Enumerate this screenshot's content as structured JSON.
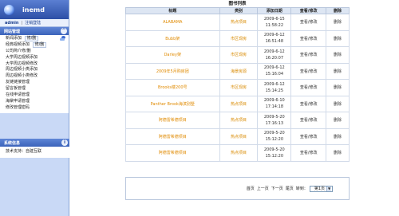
{
  "app": {
    "logo_text": "inemd"
  },
  "userbar": {
    "user": "admin",
    "sep": "|",
    "logout": "注销登陆"
  },
  "sidebar": {
    "section_title": "网站管理",
    "items": [
      {
        "label": "新闻添加",
        "sub": "修/删"
      },
      {
        "label": "经典视频添加",
        "sub": "修/删"
      },
      {
        "label": "公司简介修/删"
      },
      {
        "label": "大学周边视频添加"
      },
      {
        "label": "大学周边视频修改"
      },
      {
        "label": "周边视频小类添加"
      },
      {
        "label": "周边视频小类修改"
      },
      {
        "label": "友链链接管理"
      },
      {
        "label": "留言板管理"
      },
      {
        "label": "在线申请管理"
      },
      {
        "label": "海棠申请管理"
      },
      {
        "label": "修改管理密码"
      }
    ],
    "system_title": "系统信息",
    "system_text": "技术支持：自建互联"
  },
  "main": {
    "title": "图书列表",
    "columns": [
      "标题",
      "类别",
      "添加日期",
      "查看/修改",
      "删除"
    ],
    "rows": [
      {
        "title": "ALABAMA",
        "category": "热点项目",
        "date": "2009-6-15",
        "time": "11:58:22",
        "edit": "查看/修改",
        "del": "删除"
      },
      {
        "title": "Bubb架",
        "category": "市区现房",
        "date": "2009-6-12",
        "time": "16:51:48",
        "edit": "查看/修改",
        "del": "删除"
      },
      {
        "title": "Darley架",
        "category": "市区现房",
        "date": "2009-6-12",
        "time": "16:20:07",
        "edit": "查看/修改",
        "del": "删除"
      },
      {
        "title": "2009年5月购房团",
        "category": "海景房源",
        "date": "2009-6-12",
        "time": "15:16:04",
        "edit": "查看/修改",
        "del": "删除"
      },
      {
        "title": "Brooks楼200号",
        "category": "市区现房",
        "date": "2009-6-12",
        "time": "15:14:25",
        "edit": "查看/修改",
        "del": "删除"
      },
      {
        "title": "Panther Brook海滨别墅",
        "category": "热点项目",
        "date": "2009-6-10",
        "time": "17:14:18",
        "edit": "查看/修改",
        "del": "删除"
      },
      {
        "title": "阿德雷希德项目",
        "category": "热点项目",
        "date": "2009-5-20",
        "time": "17:16:13",
        "edit": "查看/修改",
        "del": "删除"
      },
      {
        "title": "阿德雷希德项目",
        "category": "热点项目",
        "date": "2009-5-20",
        "time": "15:12:20",
        "edit": "查看/修改",
        "del": "删除"
      },
      {
        "title": "阿德雷希德项目",
        "category": "热点项目",
        "date": "2009-5-20",
        "time": "15:12:20",
        "edit": "查看/修改",
        "del": "删除"
      }
    ]
  },
  "pager": {
    "first": "首页",
    "prev": "上一页",
    "next": "下一页",
    "last": "尾页",
    "jump_label": "转到：",
    "current": "第1页"
  }
}
